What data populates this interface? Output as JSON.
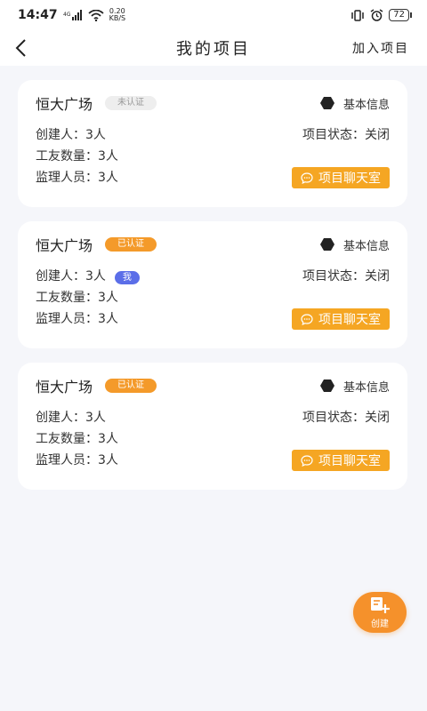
{
  "statusbar": {
    "time": "14:47",
    "net_speed_value": "0.20",
    "net_speed_unit": "KB/S",
    "battery": "72"
  },
  "nav": {
    "title": "我的项目",
    "action": "加入项目"
  },
  "projects": [
    {
      "name": "恒大广场",
      "badge": "未认证",
      "badge_type": "unverified",
      "info_label": "基本信息",
      "creator": "创建人：3人",
      "status": "项目状态：关闭",
      "workers": "工友数量：3人",
      "supervisors": "监理人员：3人",
      "chat_label": "项目聊天室"
    },
    {
      "name": "恒大广场",
      "badge": "已认证",
      "badge_type": "verified",
      "info_label": "基本信息",
      "creator": "创建人：3人",
      "me_tag": "我",
      "status": "项目状态：关闭",
      "workers": "工友数量：3人",
      "supervisors": "监理人员：3人",
      "chat_label": "项目聊天室"
    },
    {
      "name": "恒大广场",
      "badge": "已认证",
      "badge_type": "verified",
      "info_label": "基本信息",
      "creator": "创建人：3人",
      "status": "项目状态：关闭",
      "workers": "工友数量：3人",
      "supervisors": "监理人员：3人",
      "chat_label": "项目聊天室"
    }
  ],
  "fab": {
    "label": "创建"
  },
  "colors": {
    "accent": "#f5a623",
    "verified": "#f49a2a",
    "me_tag": "#5b6ee8",
    "background": "#f5f6fa"
  },
  "icons": {
    "back": "chevron-left-icon",
    "info": "hexagon-icon",
    "chat": "chat-bubble-icon",
    "create": "add-document-icon"
  }
}
